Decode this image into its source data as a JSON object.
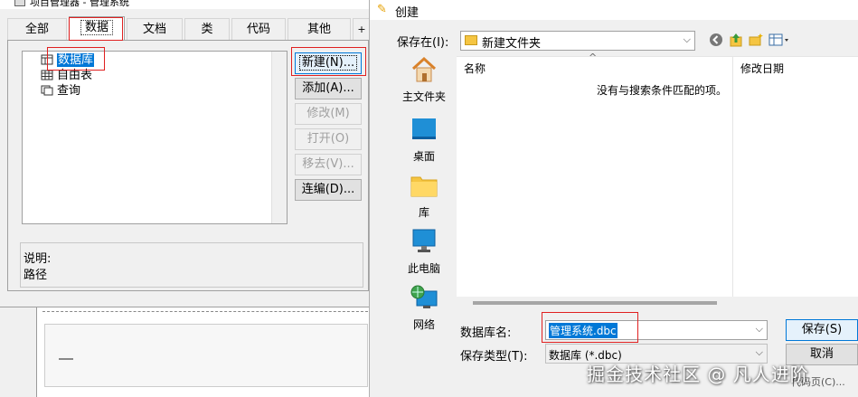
{
  "project_manager": {
    "title": "项目管理器 - 管理系统",
    "tabs": [
      "全部",
      "数据",
      "文档",
      "类",
      "代码",
      "其他"
    ],
    "tab_overflow": "+",
    "tree": [
      "数据库",
      "自由表",
      "查询"
    ],
    "buttons": {
      "new": "新建(N)...",
      "add": "添加(A)...",
      "modify": "修改(M)",
      "open": "打开(O)",
      "remove": "移去(V)...",
      "build": "连编(D)..."
    },
    "description_label": "说明:",
    "path_label": "路径"
  },
  "dialog": {
    "title": "创建",
    "save_in_label": "保存在(I):",
    "save_in_value": "新建文件夹",
    "places": [
      "主文件夹",
      "桌面",
      "库",
      "此电脑",
      "网络"
    ],
    "columns": {
      "name": "名称",
      "date": "修改日期"
    },
    "empty_message": "没有与搜索条件匹配的项。",
    "filename_label": "数据库名:",
    "filename_value": "管理系统.dbc",
    "filetype_label": "保存类型(T):",
    "filetype_value": "数据库 (*.dbc)",
    "save_button": "保存(S)",
    "cancel_button": "取消",
    "help_text": "代码页(C)..."
  },
  "watermark": "掘金技术社区 @ 凡人进阶",
  "colors": {
    "highlight": "#0078d7",
    "annotation": "#e02020",
    "folder": "#f5c542"
  }
}
